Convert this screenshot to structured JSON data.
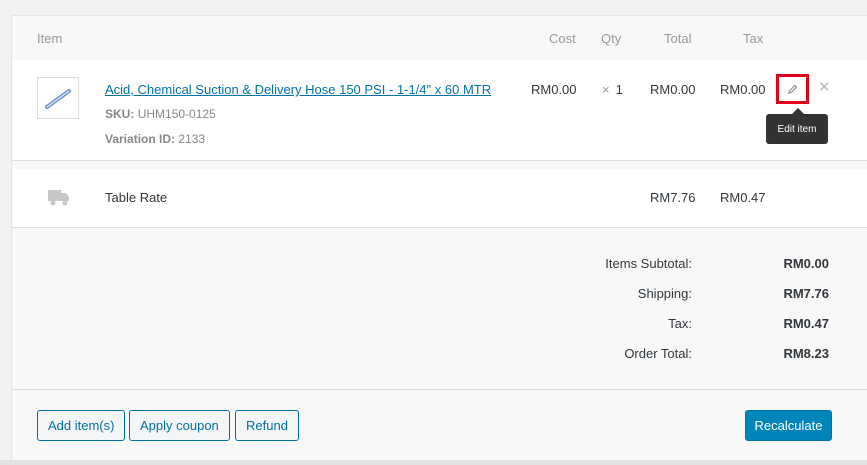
{
  "header": {
    "item": "Item",
    "cost": "Cost",
    "qty": "Qty",
    "total": "Total",
    "tax": "Tax"
  },
  "line_item": {
    "name": "Acid, Chemical Suction & Delivery Hose 150 PSI - 1-1/4\" x 60 MTR",
    "sku_label": "SKU:",
    "sku": "UHM150-0125",
    "variation_label": "Variation ID:",
    "variation_id": "2133",
    "cost": "RM0.00",
    "qty_prefix": "×",
    "qty": "1",
    "total": "RM0.00",
    "tax": "RM0.00",
    "edit_tooltip": "Edit item",
    "icons": {
      "edit": "pencil-icon",
      "delete": "close-icon",
      "thumbnail": "hose-thumbnail"
    }
  },
  "shipping_line": {
    "name": "Table Rate",
    "total": "RM7.76",
    "tax": "RM0.47",
    "icon": "truck-icon"
  },
  "totals": {
    "subtotal_label": "Items Subtotal:",
    "subtotal": "RM0.00",
    "shipping_label": "Shipping:",
    "shipping": "RM7.76",
    "tax_label": "Tax:",
    "tax": "RM0.47",
    "order_total_label": "Order Total:",
    "order_total": "RM8.23"
  },
  "actions": {
    "add_items": "Add item(s)",
    "apply_coupon": "Apply coupon",
    "refund": "Refund",
    "recalculate": "Recalculate"
  },
  "colors": {
    "link": "#0073aa",
    "primary": "#0085ba",
    "highlight": "#e2001a"
  }
}
